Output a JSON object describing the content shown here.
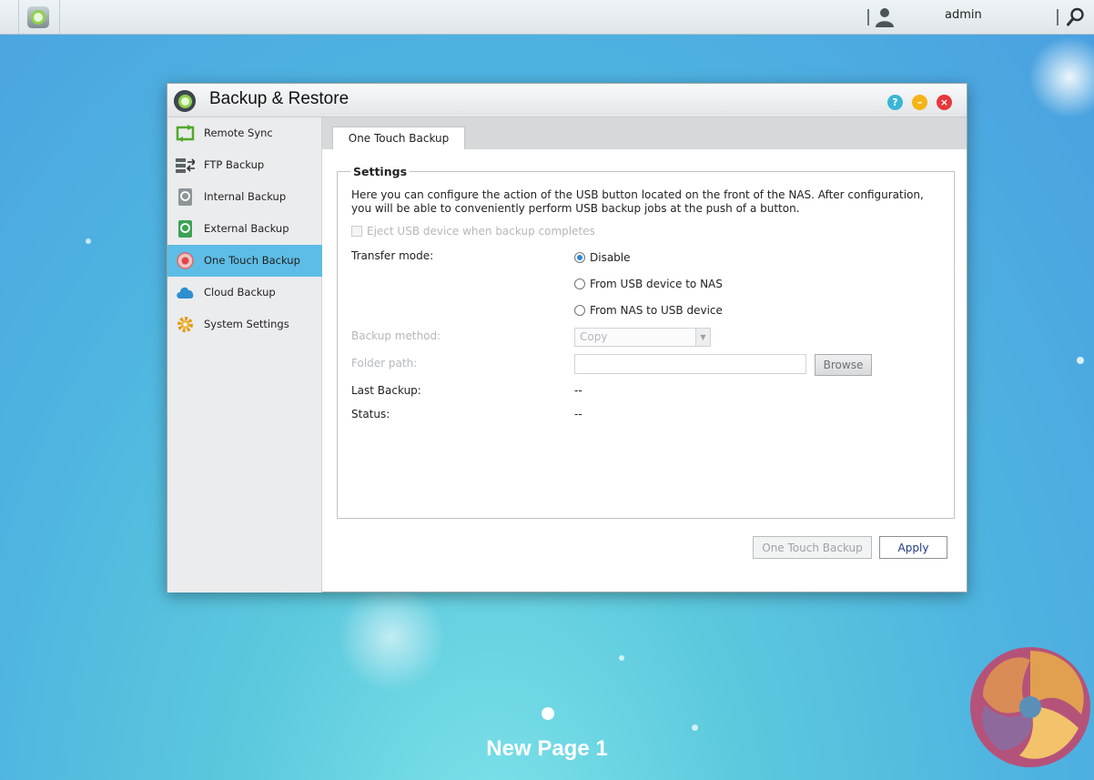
{
  "topbar": {
    "user_name": "admin"
  },
  "window": {
    "title": "Backup & Restore"
  },
  "sidebar": {
    "items": [
      {
        "label": "Remote Sync",
        "icon": "remote-sync-icon"
      },
      {
        "label": "FTP Backup",
        "icon": "ftp-backup-icon"
      },
      {
        "label": "Internal Backup",
        "icon": "internal-backup-icon"
      },
      {
        "label": "External Backup",
        "icon": "external-backup-icon"
      },
      {
        "label": "One Touch Backup",
        "icon": "one-touch-backup-icon",
        "active": true
      },
      {
        "label": "Cloud Backup",
        "icon": "cloud-icon"
      },
      {
        "label": "System Settings",
        "icon": "gear-icon"
      }
    ]
  },
  "tabs": [
    {
      "label": "One Touch Backup",
      "active": true
    }
  ],
  "settings": {
    "legend": "Settings",
    "description": "Here you can configure the action of the USB button located on the front of the NAS. After configuration, you will be able to conveniently perform USB backup jobs at the push of a button.",
    "eject_label": "Eject USB device when backup completes",
    "eject_checked": false,
    "transfer_mode_label": "Transfer mode:",
    "transfer_modes": [
      {
        "label": "Disable",
        "selected": true
      },
      {
        "label": "From USB device to NAS",
        "selected": false
      },
      {
        "label": "From NAS to USB device",
        "selected": false
      }
    ],
    "backup_method_label": "Backup method:",
    "backup_method_value": "Copy",
    "folder_path_label": "Folder path:",
    "folder_path_value": "",
    "browse_label": "Browse",
    "last_backup_label": "Last Backup:",
    "last_backup_value": "--",
    "status_label": "Status:",
    "status_value": "--"
  },
  "footer": {
    "one_touch_backup_label": "One Touch Backup",
    "apply_label": "Apply"
  },
  "desktop": {
    "page_label": "New Page 1"
  },
  "colors": {
    "active_sidebar": "#5ebde6",
    "apply_text": "#1f3a8a"
  }
}
